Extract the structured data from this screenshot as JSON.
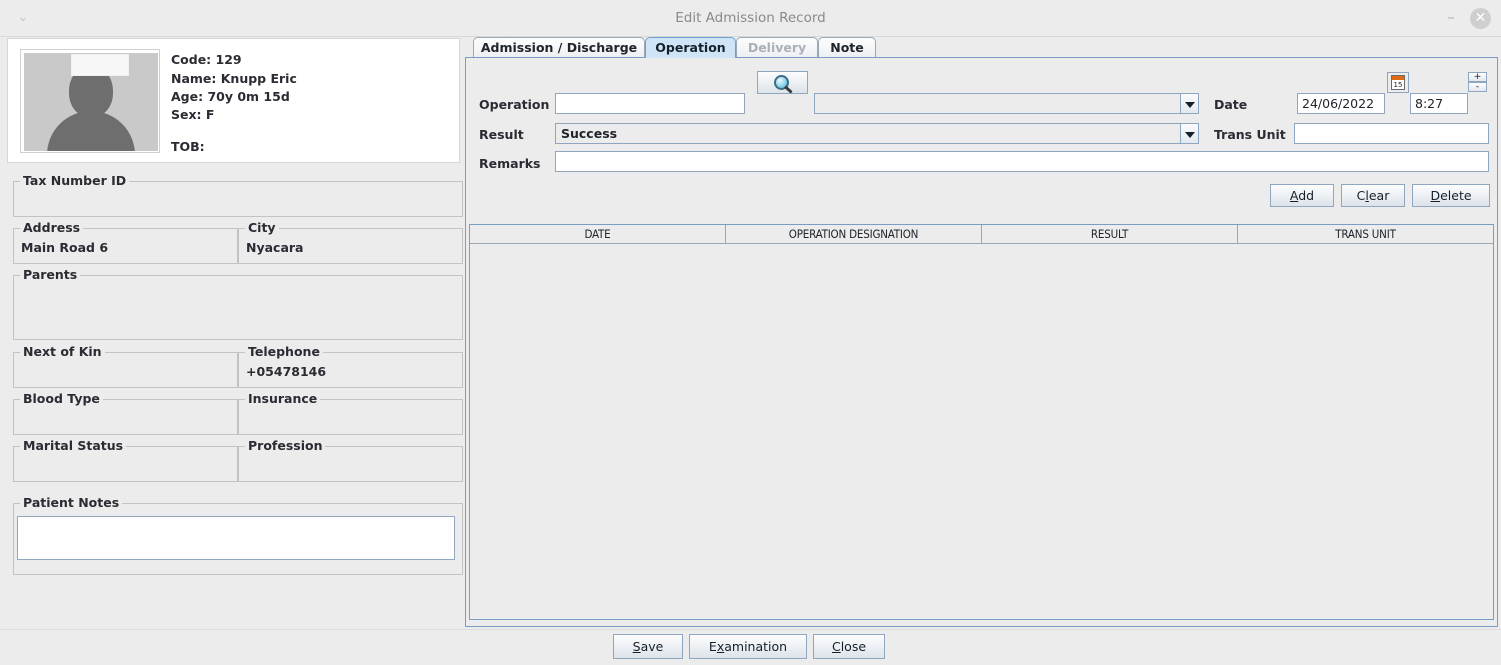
{
  "window": {
    "title": "Edit Admission Record",
    "minimize_label": "–",
    "close_label": "✕",
    "chevron_label": "⌄"
  },
  "patient": {
    "code": "Code: 129",
    "name": "Name: Knupp Eric",
    "age": "Age: 70y 0m 15d",
    "sex": "Sex: F",
    "tob": "TOB:",
    "avatar_icon": "person-placeholder-icon"
  },
  "fields": [
    {
      "label": "Tax Number ID",
      "value": ""
    },
    {
      "label": "Address",
      "value": "Main Road 6"
    },
    {
      "label": "City",
      "value": "Nyacara"
    },
    {
      "label": "Parents",
      "value": ""
    },
    {
      "label": "Next of Kin",
      "value": ""
    },
    {
      "label": "Telephone",
      "value": "+05478146"
    },
    {
      "label": "Blood Type",
      "value": ""
    },
    {
      "label": "Insurance",
      "value": ""
    },
    {
      "label": "Marital Status",
      "value": ""
    },
    {
      "label": "Profession",
      "value": ""
    },
    {
      "label": "Patient Notes",
      "value": ""
    }
  ],
  "tabs": [
    {
      "label": "Admission / Discharge",
      "state": "normal"
    },
    {
      "label": "Operation",
      "state": "selected"
    },
    {
      "label": "Delivery",
      "state": "disabled"
    },
    {
      "label": "Note",
      "state": "normal"
    }
  ],
  "form": {
    "operation_label": "Operation",
    "operation_value": "",
    "operation_combo_value": "",
    "search_icon": "magnifier-icon",
    "result_label": "Result",
    "result_value": "Success",
    "remarks_label": "Remarks",
    "remarks_value": "",
    "date_label": "Date",
    "date_value": "24/06/2022",
    "calendar_icon": "calendar-icon",
    "calendar_day": "15",
    "time_value": "8:27",
    "spinner_up": "+",
    "spinner_down": "-",
    "trans_unit_label": "Trans Unit",
    "trans_unit_value": ""
  },
  "actions": {
    "add": {
      "pre": "",
      "mn": "A",
      "post": "dd"
    },
    "clear": {
      "pre": "C",
      "mn": "l",
      "post": "ear"
    },
    "delete": {
      "pre": "",
      "mn": "D",
      "post": "elete"
    }
  },
  "table": {
    "columns": [
      "DATE",
      "OPERATION DESIGNATION",
      "RESULT",
      "TRANS UNIT"
    ],
    "rows": []
  },
  "footer": {
    "save": {
      "pre": "",
      "mn": "S",
      "post": "ave"
    },
    "examination": {
      "pre": "E",
      "mn": "x",
      "post": "amination"
    },
    "close": {
      "pre": "",
      "mn": "C",
      "post": "lose"
    }
  },
  "colors": {
    "window_bg": "#ececec",
    "tab_selected": "#cfe5f7",
    "border_blue": "#7a9cc6",
    "text": "#2b2b33",
    "title_text": "#8a8a8a"
  }
}
